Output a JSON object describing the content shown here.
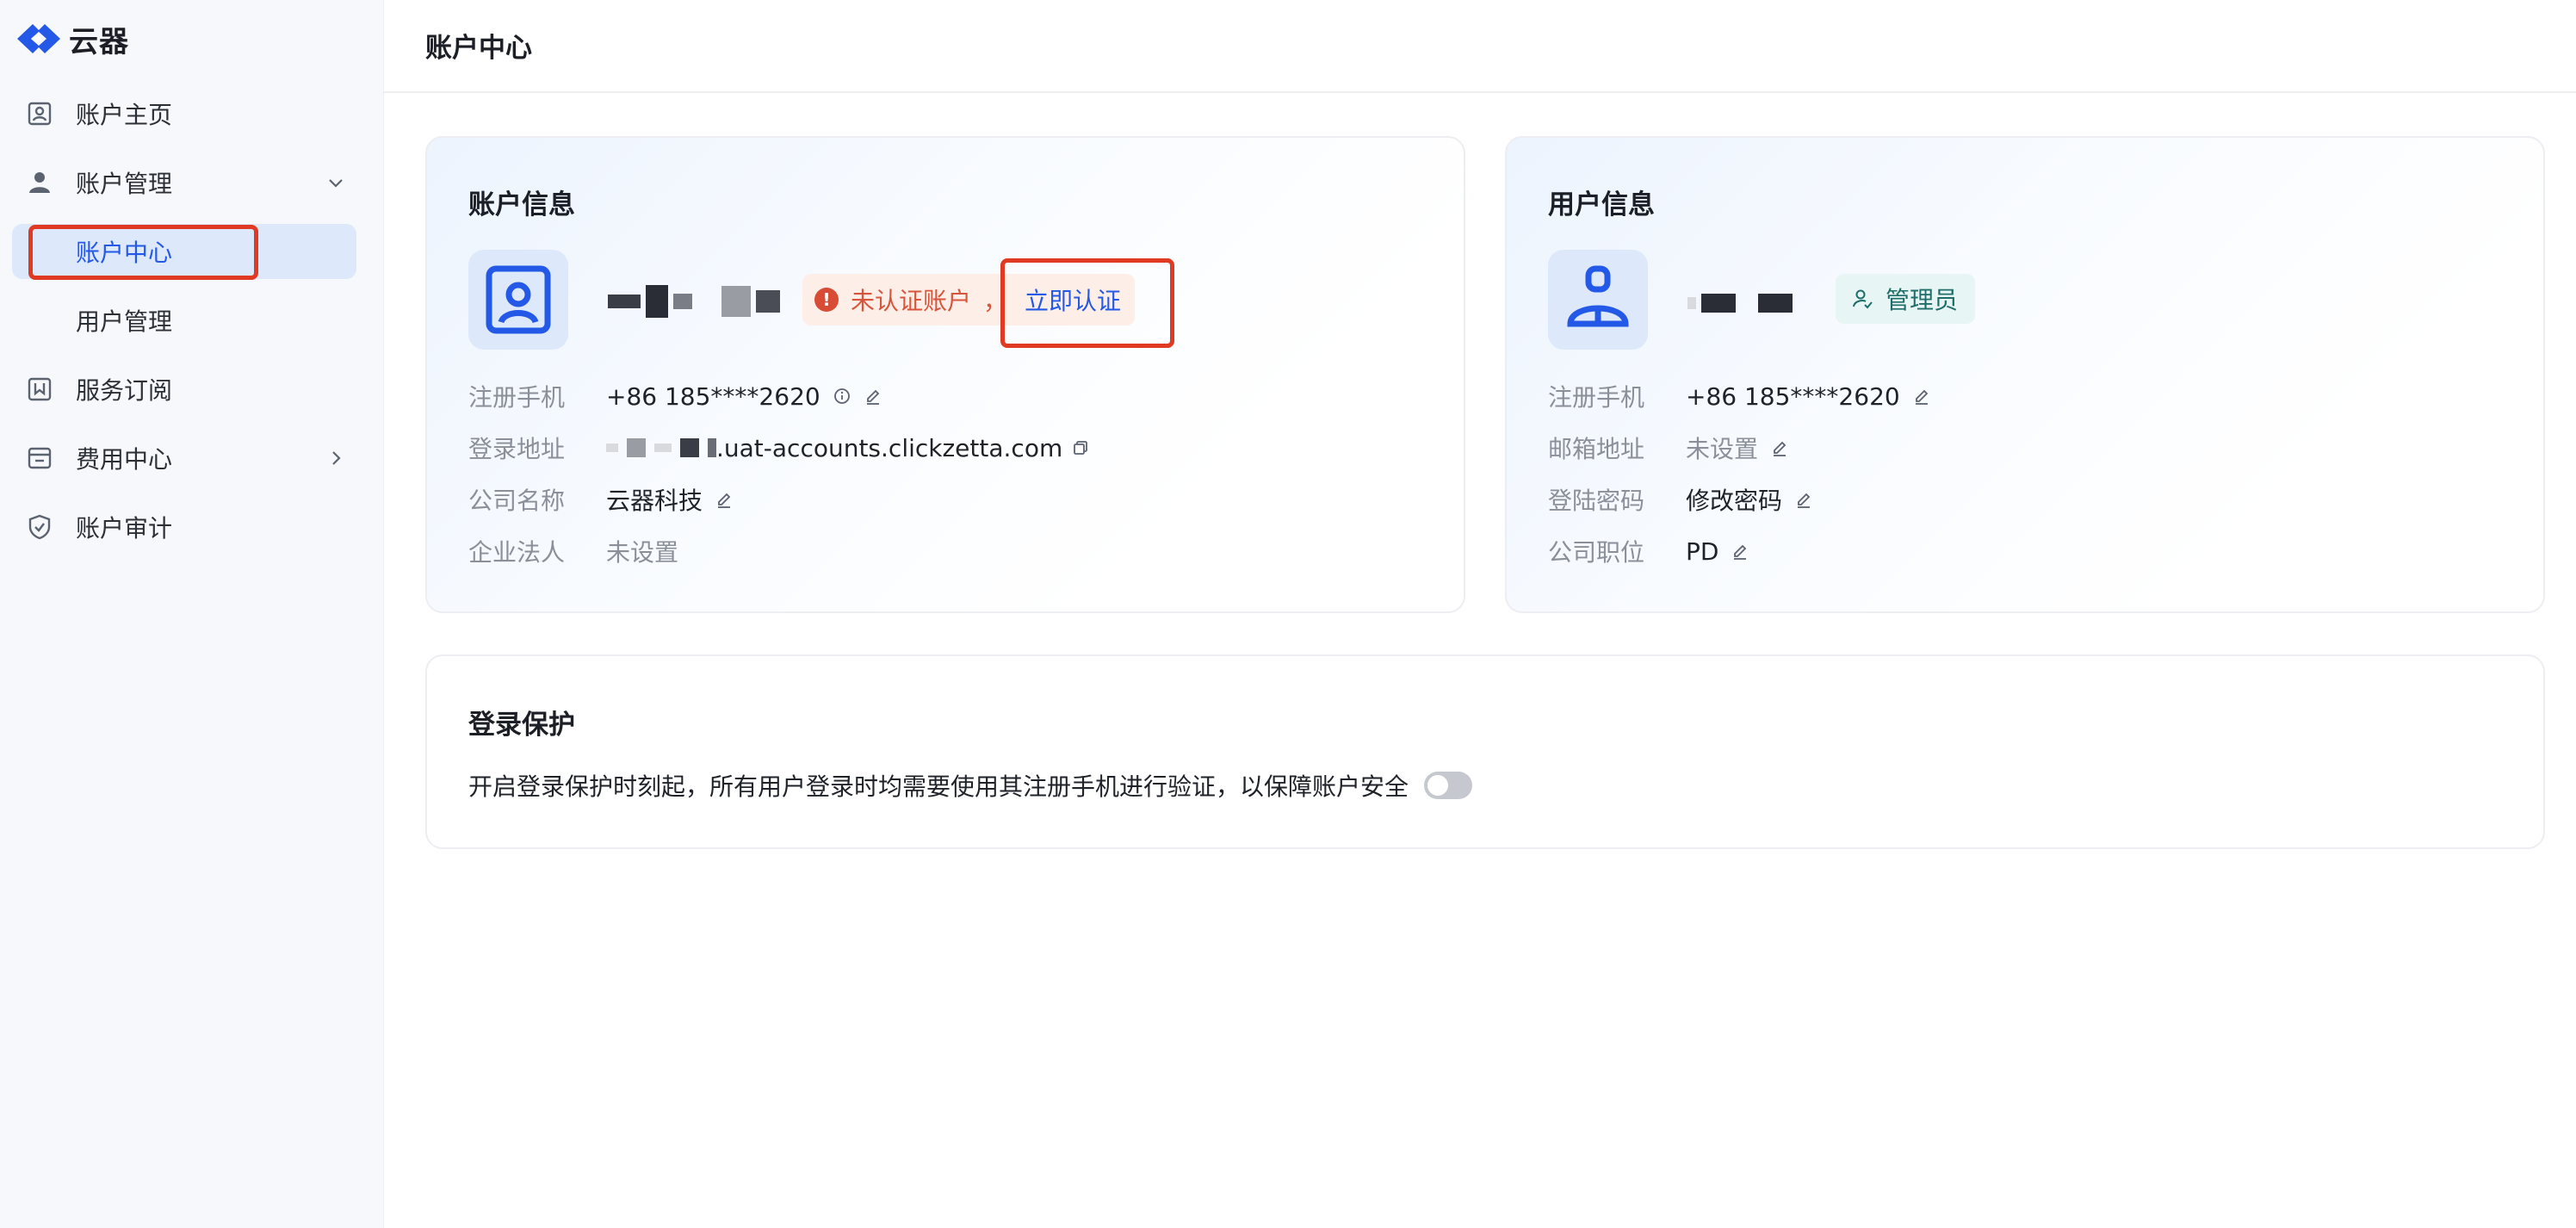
{
  "brand": {
    "name": "云器"
  },
  "sidebar": {
    "items": [
      {
        "label": "账户主页"
      },
      {
        "label": "账户管理"
      },
      {
        "label": "账户中心"
      },
      {
        "label": "用户管理"
      },
      {
        "label": "服务订阅"
      },
      {
        "label": "费用中心"
      },
      {
        "label": "账户审计"
      }
    ]
  },
  "header": {
    "title": "账户中心"
  },
  "account_card": {
    "title": "账户信息",
    "status_badge": "未认证账户",
    "status_separator": "，",
    "verify_link": "立即认证",
    "rows": [
      {
        "label": "注册手机",
        "value": "+86 185****2620"
      },
      {
        "label": "登录地址",
        "value": ".uat-accounts.clickzetta.com"
      },
      {
        "label": "公司名称",
        "value": "云器科技"
      },
      {
        "label": "企业法人",
        "value": "未设置"
      }
    ]
  },
  "user_card": {
    "title": "用户信息",
    "role_badge": "管理员",
    "rows": [
      {
        "label": "注册手机",
        "value": "+86 185****2620"
      },
      {
        "label": "邮箱地址",
        "value": "未设置"
      },
      {
        "label": "登陆密码",
        "value": "修改密码"
      },
      {
        "label": "公司职位",
        "value": "PD"
      }
    ]
  },
  "login_protection": {
    "title": "登录保护",
    "description": "开启登录保护时刻起，所有用户登录时均需要使用其注册手机进行验证，以保障账户安全",
    "enabled": false
  },
  "colors": {
    "accent": "#2458e6",
    "warning": "#d84b35",
    "highlight_box": "#e03a22",
    "admin_badge": "#1f6d6a"
  }
}
